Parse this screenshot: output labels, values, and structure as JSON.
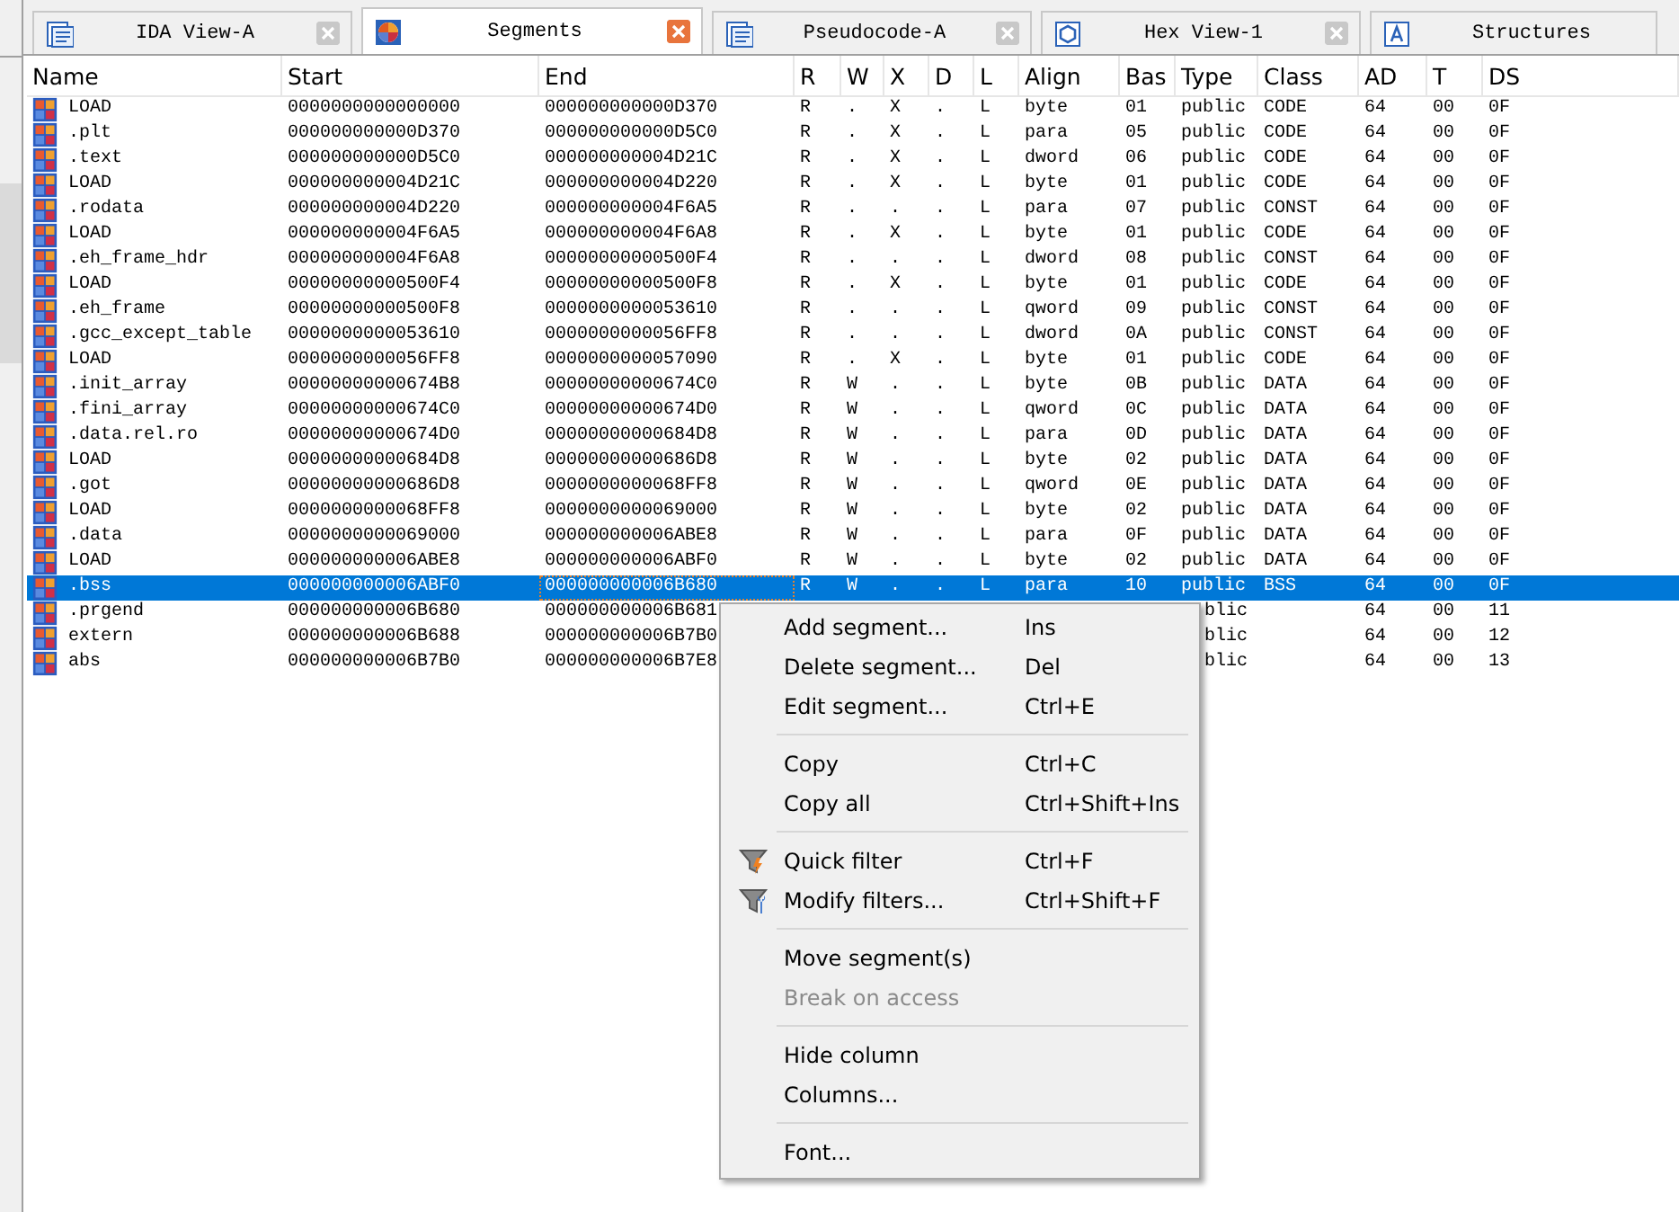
{
  "tabs": [
    {
      "label": "IDA View-A",
      "kind": "listing",
      "selected": false,
      "closable": true
    },
    {
      "label": "Segments",
      "kind": "segments",
      "selected": true,
      "closable": true
    },
    {
      "label": "Pseudocode-A",
      "kind": "listing",
      "selected": false,
      "closable": true
    },
    {
      "label": "Hex View-1",
      "kind": "hex",
      "selected": false,
      "closable": true
    },
    {
      "label": "Structures",
      "kind": "struct",
      "selected": false,
      "closable": false
    }
  ],
  "table": {
    "columns": [
      "Name",
      "Start",
      "End",
      "R",
      "W",
      "X",
      "D",
      "L",
      "Align",
      "Bas",
      "Type",
      "Class",
      "AD",
      "T",
      "DS"
    ],
    "rows": [
      {
        "cells": [
          "LOAD",
          "0000000000000000",
          "000000000000D370",
          "R",
          ".",
          "X",
          ".",
          "L",
          "byte",
          "01",
          "public",
          "CODE",
          "64",
          "00",
          "0F"
        ],
        "selected": false,
        "covered": false
      },
      {
        "cells": [
          ".plt",
          "000000000000D370",
          "000000000000D5C0",
          "R",
          ".",
          "X",
          ".",
          "L",
          "para",
          "05",
          "public",
          "CODE",
          "64",
          "00",
          "0F"
        ],
        "selected": false,
        "covered": false
      },
      {
        "cells": [
          ".text",
          "000000000000D5C0",
          "000000000004D21C",
          "R",
          ".",
          "X",
          ".",
          "L",
          "dword",
          "06",
          "public",
          "CODE",
          "64",
          "00",
          "0F"
        ],
        "selected": false,
        "covered": false
      },
      {
        "cells": [
          "LOAD",
          "000000000004D21C",
          "000000000004D220",
          "R",
          ".",
          "X",
          ".",
          "L",
          "byte",
          "01",
          "public",
          "CODE",
          "64",
          "00",
          "0F"
        ],
        "selected": false,
        "covered": false
      },
      {
        "cells": [
          ".rodata",
          "000000000004D220",
          "000000000004F6A5",
          "R",
          ".",
          ".",
          ".",
          "L",
          "para",
          "07",
          "public",
          "CONST",
          "64",
          "00",
          "0F"
        ],
        "selected": false,
        "covered": false
      },
      {
        "cells": [
          "LOAD",
          "000000000004F6A5",
          "000000000004F6A8",
          "R",
          ".",
          "X",
          ".",
          "L",
          "byte",
          "01",
          "public",
          "CODE",
          "64",
          "00",
          "0F"
        ],
        "selected": false,
        "covered": false
      },
      {
        "cells": [
          ".eh_frame_hdr",
          "000000000004F6A8",
          "00000000000500F4",
          "R",
          ".",
          ".",
          ".",
          "L",
          "dword",
          "08",
          "public",
          "CONST",
          "64",
          "00",
          "0F"
        ],
        "selected": false,
        "covered": false
      },
      {
        "cells": [
          "LOAD",
          "00000000000500F4",
          "00000000000500F8",
          "R",
          ".",
          "X",
          ".",
          "L",
          "byte",
          "01",
          "public",
          "CODE",
          "64",
          "00",
          "0F"
        ],
        "selected": false,
        "covered": false
      },
      {
        "cells": [
          ".eh_frame",
          "00000000000500F8",
          "0000000000053610",
          "R",
          ".",
          ".",
          ".",
          "L",
          "qword",
          "09",
          "public",
          "CONST",
          "64",
          "00",
          "0F"
        ],
        "selected": false,
        "covered": false
      },
      {
        "cells": [
          ".gcc_except_table",
          "0000000000053610",
          "0000000000056FF8",
          "R",
          ".",
          ".",
          ".",
          "L",
          "dword",
          "0A",
          "public",
          "CONST",
          "64",
          "00",
          "0F"
        ],
        "selected": false,
        "covered": false
      },
      {
        "cells": [
          "LOAD",
          "0000000000056FF8",
          "0000000000057090",
          "R",
          ".",
          "X",
          ".",
          "L",
          "byte",
          "01",
          "public",
          "CODE",
          "64",
          "00",
          "0F"
        ],
        "selected": false,
        "covered": false
      },
      {
        "cells": [
          ".init_array",
          "00000000000674B8",
          "00000000000674C0",
          "R",
          "W",
          ".",
          ".",
          "L",
          "byte",
          "0B",
          "public",
          "DATA",
          "64",
          "00",
          "0F"
        ],
        "selected": false,
        "covered": false
      },
      {
        "cells": [
          ".fini_array",
          "00000000000674C0",
          "00000000000674D0",
          "R",
          "W",
          ".",
          ".",
          "L",
          "qword",
          "0C",
          "public",
          "DATA",
          "64",
          "00",
          "0F"
        ],
        "selected": false,
        "covered": false
      },
      {
        "cells": [
          ".data.rel.ro",
          "00000000000674D0",
          "00000000000684D8",
          "R",
          "W",
          ".",
          ".",
          "L",
          "para",
          "0D",
          "public",
          "DATA",
          "64",
          "00",
          "0F"
        ],
        "selected": false,
        "covered": false
      },
      {
        "cells": [
          "LOAD",
          "00000000000684D8",
          "00000000000686D8",
          "R",
          "W",
          ".",
          ".",
          "L",
          "byte",
          "02",
          "public",
          "DATA",
          "64",
          "00",
          "0F"
        ],
        "selected": false,
        "covered": false
      },
      {
        "cells": [
          ".got",
          "00000000000686D8",
          "0000000000068FF8",
          "R",
          "W",
          ".",
          ".",
          "L",
          "qword",
          "0E",
          "public",
          "DATA",
          "64",
          "00",
          "0F"
        ],
        "selected": false,
        "covered": false
      },
      {
        "cells": [
          "LOAD",
          "0000000000068FF8",
          "0000000000069000",
          "R",
          "W",
          ".",
          ".",
          "L",
          "byte",
          "02",
          "public",
          "DATA",
          "64",
          "00",
          "0F"
        ],
        "selected": false,
        "covered": false
      },
      {
        "cells": [
          ".data",
          "0000000000069000",
          "000000000006ABE8",
          "R",
          "W",
          ".",
          ".",
          "L",
          "para",
          "0F",
          "public",
          "DATA",
          "64",
          "00",
          "0F"
        ],
        "selected": false,
        "covered": false
      },
      {
        "cells": [
          "LOAD",
          "000000000006ABE8",
          "000000000006ABF0",
          "R",
          "W",
          ".",
          ".",
          "L",
          "byte",
          "02",
          "public",
          "DATA",
          "64",
          "00",
          "0F"
        ],
        "selected": false,
        "covered": false
      },
      {
        "cells": [
          ".bss",
          "000000000006ABF0",
          "000000000006B680",
          "R",
          "W",
          ".",
          ".",
          "L",
          "para",
          "10",
          "public",
          "BSS",
          "64",
          "00",
          "0F"
        ],
        "selected": true,
        "covered": false
      },
      {
        "cells": [
          ".prgend",
          "000000000006B680",
          "000000000006B681",
          null,
          null,
          null,
          null,
          null,
          null,
          null,
          "blic",
          null,
          "64",
          "00",
          "11"
        ],
        "selected": false,
        "covered": true
      },
      {
        "cells": [
          "extern",
          "000000000006B688",
          "000000000006B7B0",
          null,
          null,
          null,
          null,
          null,
          null,
          null,
          "blic",
          null,
          "64",
          "00",
          "12"
        ],
        "selected": false,
        "covered": true
      },
      {
        "cells": [
          "abs",
          "000000000006B7B0",
          "000000000006B7E8",
          null,
          null,
          null,
          null,
          null,
          null,
          null,
          "blic",
          null,
          "64",
          "00",
          "13"
        ],
        "selected": false,
        "covered": true
      }
    ]
  },
  "context_menu": {
    "items": [
      {
        "kind": "item",
        "label": "Add segment...",
        "shortcut": "Ins",
        "disabled": false
      },
      {
        "kind": "item",
        "label": "Delete segment...",
        "shortcut": "Del",
        "disabled": false
      },
      {
        "kind": "item",
        "label": "Edit segment...",
        "shortcut": "Ctrl+E",
        "disabled": false
      },
      {
        "kind": "separator"
      },
      {
        "kind": "item",
        "label": "Copy",
        "shortcut": "Ctrl+C",
        "disabled": false
      },
      {
        "kind": "item",
        "label": "Copy all",
        "shortcut": "Ctrl+Shift+Ins",
        "disabled": false
      },
      {
        "kind": "separator"
      },
      {
        "kind": "filter",
        "label": "Quick filter",
        "shortcut": "Ctrl+F",
        "disabled": false
      },
      {
        "kind": "filteredit",
        "label": "Modify filters...",
        "shortcut": "Ctrl+Shift+F",
        "disabled": false
      },
      {
        "kind": "separator"
      },
      {
        "kind": "item",
        "label": "Move segment(s)",
        "disabled": false
      },
      {
        "kind": "item",
        "label": "Break on access",
        "disabled": true
      },
      {
        "kind": "separator"
      },
      {
        "kind": "item",
        "label": "Hide column",
        "disabled": false
      },
      {
        "kind": "item",
        "label": "Columns...",
        "disabled": false
      },
      {
        "kind": "separator"
      },
      {
        "kind": "item",
        "label": "Font...",
        "disabled": false
      }
    ]
  }
}
